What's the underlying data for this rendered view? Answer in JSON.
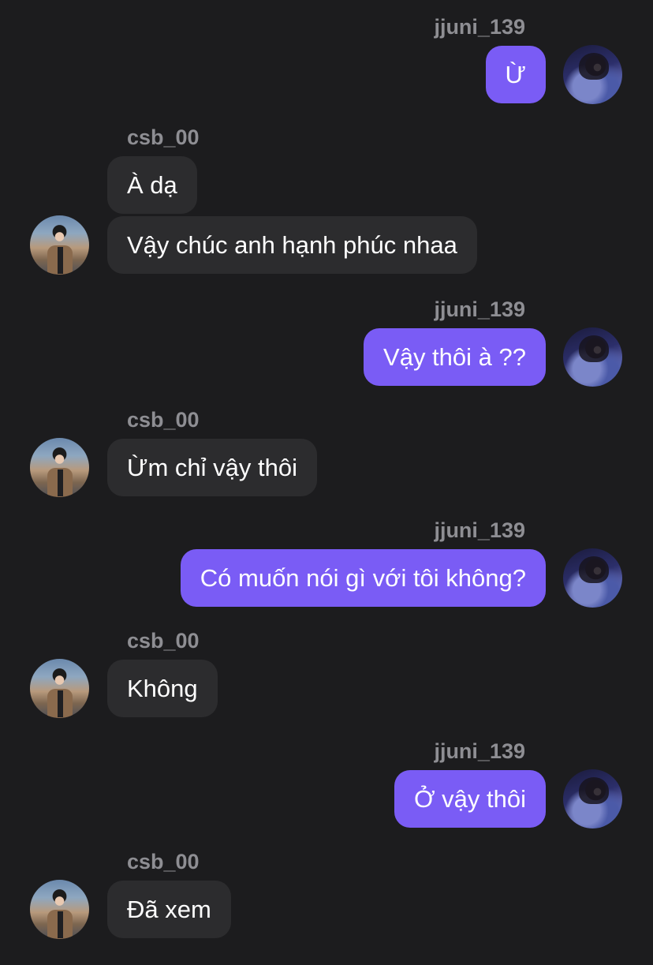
{
  "conversation": {
    "messages": [
      {
        "id": "m1",
        "sender": "jjuni_139",
        "side": "sent",
        "text": "Ừ",
        "show_name": true
      },
      {
        "id": "m2",
        "sender": "csb_00",
        "side": "recv",
        "text": "À dạ",
        "show_name": true
      },
      {
        "id": "m3",
        "sender": "csb_00",
        "side": "recv",
        "text": "Vậy chúc anh hạnh phúc nhaa",
        "show_name": false
      },
      {
        "id": "m4",
        "sender": "jjuni_139",
        "side": "sent",
        "text": "Vậy thôi à ??",
        "show_name": true
      },
      {
        "id": "m5",
        "sender": "csb_00",
        "side": "recv",
        "text": "Ừm chỉ vậy thôi",
        "show_name": true
      },
      {
        "id": "m6",
        "sender": "jjuni_139",
        "side": "sent",
        "text": "Có muốn nói gì với tôi không?",
        "show_name": true
      },
      {
        "id": "m7",
        "sender": "csb_00",
        "side": "recv",
        "text": "Không",
        "show_name": true
      },
      {
        "id": "m8",
        "sender": "jjuni_139",
        "side": "sent",
        "text": "Ở vậy thôi",
        "show_name": true
      },
      {
        "id": "m9",
        "sender": "csb_00",
        "side": "recv",
        "text": "Đã xem",
        "show_name": true
      }
    ]
  },
  "colors": {
    "background": "#1c1c1e",
    "sent_bubble": "#7a5cf5",
    "received_bubble": "#2c2c2e",
    "username": "#8e8e93",
    "message_text": "#ffffff"
  }
}
